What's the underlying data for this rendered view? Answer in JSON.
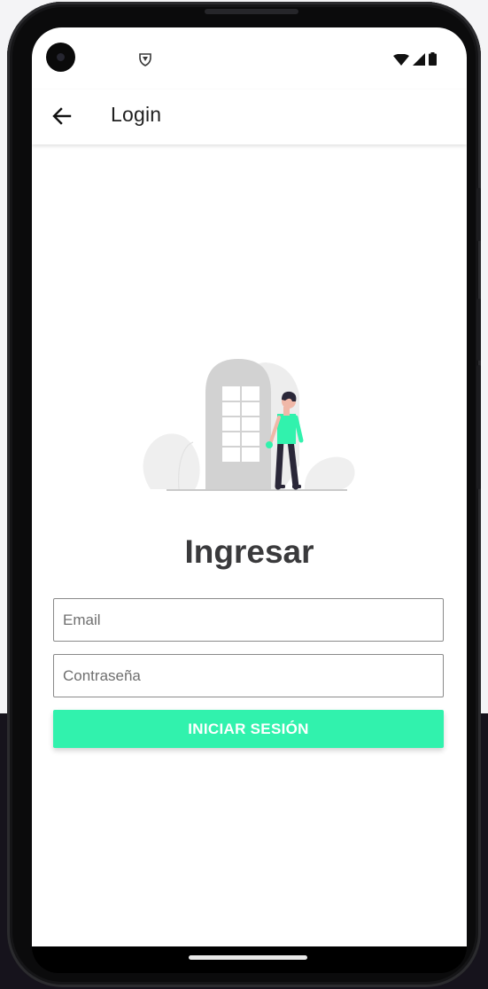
{
  "app": {
    "title": "Login"
  },
  "status_bar": {
    "icons": [
      "camera-cutout",
      "shield-icon",
      "wifi-icon",
      "cellular-signal-icon",
      "battery-icon"
    ]
  },
  "app_bar": {
    "back_icon": "arrow-back-icon",
    "title": "Login"
  },
  "main": {
    "illustration": "person-at-door-illustration",
    "heading": "Ingresar",
    "email": {
      "placeholder": "Email",
      "value": ""
    },
    "password": {
      "placeholder": "Contraseña",
      "value": ""
    },
    "submit_label": "INICIAR SESIÓN"
  },
  "colors": {
    "accent": "#31f2ad",
    "heading": "#3a3a3c",
    "door": "#d0d0d0",
    "background": "#ffffff"
  }
}
